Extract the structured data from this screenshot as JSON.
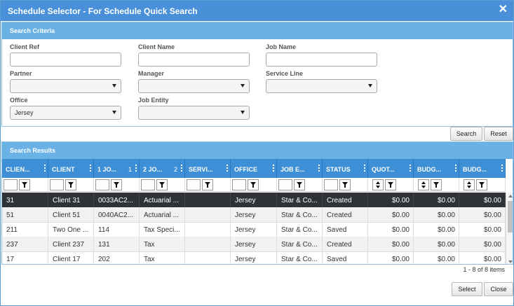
{
  "dialog": {
    "title": "Schedule Selector - For Schedule Quick Search",
    "close_glyph": "✕"
  },
  "criteria": {
    "header": "Search Criteria",
    "client_ref": {
      "label": "Client Ref",
      "value": ""
    },
    "client_name": {
      "label": "Client Name",
      "value": ""
    },
    "job_name": {
      "label": "Job Name",
      "value": ""
    },
    "partner": {
      "label": "Partner",
      "value": ""
    },
    "manager": {
      "label": "Manager",
      "value": ""
    },
    "service_line": {
      "label": "Service Line",
      "value": ""
    },
    "office": {
      "label": "Office",
      "value": "Jersey"
    },
    "job_entity": {
      "label": "Job Entity",
      "value": ""
    },
    "search_button": "Search",
    "reset_button": "Reset"
  },
  "results": {
    "header": "Search Results",
    "columns": [
      {
        "label": "CLIEN...",
        "sort_index": ""
      },
      {
        "label": "CLIENT",
        "sort_index": ""
      },
      {
        "label": "1 JO...",
        "sort_index": "1"
      },
      {
        "label": "2 JO...",
        "sort_index": "2"
      },
      {
        "label": "SERVI...",
        "sort_index": ""
      },
      {
        "label": "OFFICE",
        "sort_index": ""
      },
      {
        "label": "JOB E...",
        "sort_index": ""
      },
      {
        "label": "STATUS",
        "sort_index": ""
      },
      {
        "label": "QUOT...",
        "sort_index": ""
      },
      {
        "label": "BUDG...",
        "sort_index": ""
      },
      {
        "label": "BUDG...",
        "sort_index": ""
      }
    ],
    "rows": [
      {
        "c0": "31",
        "c1": "Client 31",
        "c2": "0033AC2...",
        "c3": "Actuarial ...",
        "c4": "",
        "c5": "Jersey",
        "c6": "Star & Co...",
        "c7": "Created",
        "c8": "$0.00",
        "c9": "$0.00",
        "c10": "$0.00"
      },
      {
        "c0": "51",
        "c1": "Client 51",
        "c2": "0040AC2...",
        "c3": "Actuarial ...",
        "c4": "",
        "c5": "Jersey",
        "c6": "Star & Co...",
        "c7": "Created",
        "c8": "$0.00",
        "c9": "$0.00",
        "c10": "$0.00"
      },
      {
        "c0": "211",
        "c1": "Two One ...",
        "c2": "114",
        "c3": "Tax Speci...",
        "c4": "",
        "c5": "Jersey",
        "c6": "Star & Co...",
        "c7": "Saved",
        "c8": "$0.00",
        "c9": "$0.00",
        "c10": "$0.00"
      },
      {
        "c0": "237",
        "c1": "Client 237",
        "c2": "131",
        "c3": "Tax",
        "c4": "",
        "c5": "Jersey",
        "c6": "Star & Co...",
        "c7": "Created",
        "c8": "$0.00",
        "c9": "$0.00",
        "c10": "$0.00"
      },
      {
        "c0": "17",
        "c1": "Client 17",
        "c2": "202",
        "c3": "Tax",
        "c4": "",
        "c5": "Jersey",
        "c6": "Star & Co...",
        "c7": "Saved",
        "c8": "$0.00",
        "c9": "$0.00",
        "c10": "$0.00"
      }
    ],
    "selected_row": 0,
    "pager_text": "1 - 8 of 8 items"
  },
  "footer": {
    "select_button": "Select",
    "close_button": "Close"
  },
  "colors": {
    "titlebar": "#4a90d9",
    "panel_header": "#6ab2e6",
    "grid_header": "#3d8fd6",
    "selected_row": "#2f3338"
  }
}
